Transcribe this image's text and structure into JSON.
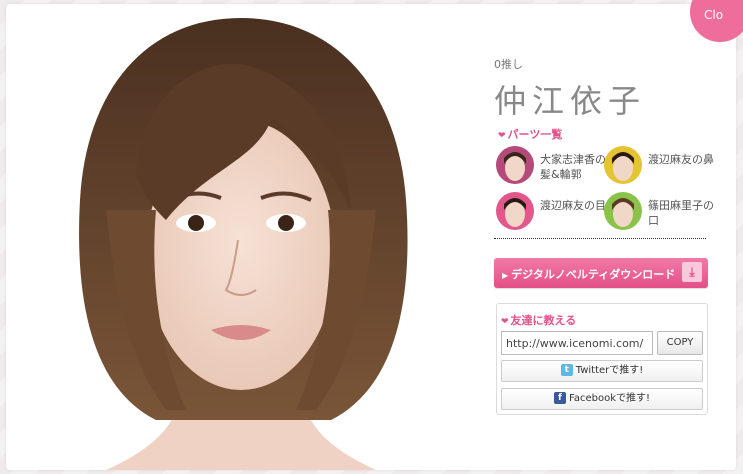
{
  "close_button": {
    "label": "Clo"
  },
  "profile": {
    "oshi_count": "0推し",
    "name": "仲江依子"
  },
  "parts": {
    "heading": "パーツ一覧",
    "items": [
      {
        "label": "大家志津香の髪&輪郭",
        "color": "#b44a7a"
      },
      {
        "label": "渡辺麻友の鼻",
        "color": "#e5c431"
      },
      {
        "label": "渡辺麻友の目",
        "color": "#e2588c"
      },
      {
        "label": "篠田麻里子の口",
        "color": "#8bc34a"
      }
    ]
  },
  "download_button": {
    "label": "デジタルノベルティダウンロード"
  },
  "share": {
    "heading": "友達に教える",
    "url_value": "http://www.icenomi.com/",
    "copy_label": "COPY",
    "twitter_label": "Twitterで推す!",
    "facebook_label": "Facebookで推す!"
  },
  "colors": {
    "accent_pink": "#e34f88",
    "hair_brown": "#6b4a34",
    "skin": "#f1d7c8"
  }
}
